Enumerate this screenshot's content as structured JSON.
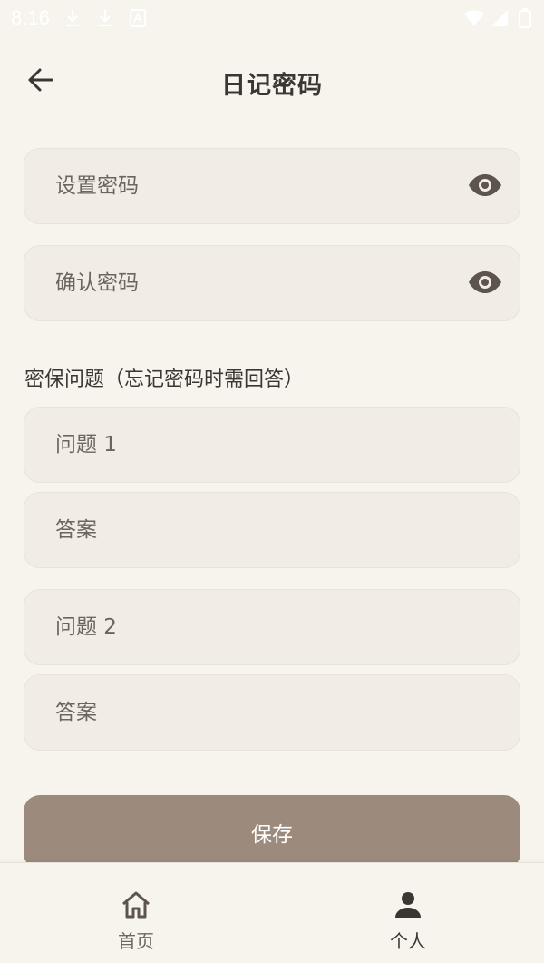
{
  "status_bar": {
    "time": "8:16",
    "left_icons": [
      "download-icon",
      "download-icon",
      "font-a-icon"
    ],
    "right_icons": [
      "wifi-icon",
      "signal-icon",
      "battery-icon"
    ]
  },
  "app_bar": {
    "title": "日记密码",
    "back_icon": "arrow-left-icon"
  },
  "password": {
    "set_placeholder": "设置密码",
    "confirm_placeholder": "确认密码",
    "visibility_icon": "eye-icon"
  },
  "security": {
    "section_label": "密保问题（忘记密码时需回答）",
    "q1_placeholder": "问题 1",
    "a1_placeholder": "答案",
    "q2_placeholder": "问题 2",
    "a2_placeholder": "答案"
  },
  "actions": {
    "save_label": "保存"
  },
  "bottom_nav": {
    "items": [
      {
        "label": "首页",
        "icon": "home-icon",
        "active": false
      },
      {
        "label": "个人",
        "icon": "person-icon",
        "active": true
      }
    ]
  },
  "colors": {
    "background": "#f7f4ee",
    "field_bg": "#f1ede6",
    "accent_button": "#9c8b7c",
    "text_primary": "#3b3631",
    "icon": "#5c544d"
  }
}
